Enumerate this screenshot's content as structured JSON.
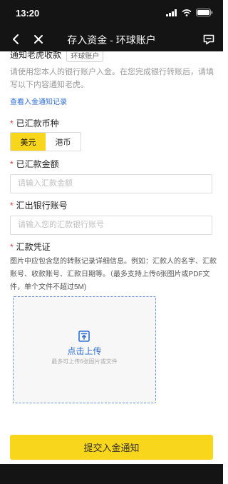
{
  "status": {
    "time": "13:20"
  },
  "header": {
    "title": "存入资金 - 环球账户"
  },
  "notice": {
    "title": "通知老虎收款",
    "tag": "环球账户",
    "description": "请使用您本人的银行账户入金。在您完成银行转账后，请填写以下内容通知老虎。",
    "link": "查看入金通知记录"
  },
  "currency": {
    "label": "已汇款币种",
    "options": [
      "美元",
      "港币"
    ],
    "selected": "美元"
  },
  "amount": {
    "label": "已汇款金额",
    "placeholder": "请输入汇款金额"
  },
  "account": {
    "label": "汇出银行账号",
    "placeholder": "请输入您的汇款银行账号"
  },
  "voucher": {
    "label": "汇款凭证",
    "hint": "图片中应包含您的转账记录详细信息。例如：汇款人的名字、汇款账号、收款账号、汇款日期等。（最多支持上传6张图片或PDF文件，单个文件不超过5M)",
    "upload_text": "点击上传",
    "upload_sub": "最多可上传6张图片或文件"
  },
  "submit": {
    "label": "提交入金通知"
  },
  "colors": {
    "accent": "#f8d61c",
    "link": "#2f6fd6",
    "required": "#e23b3b",
    "bar": "#141414"
  }
}
